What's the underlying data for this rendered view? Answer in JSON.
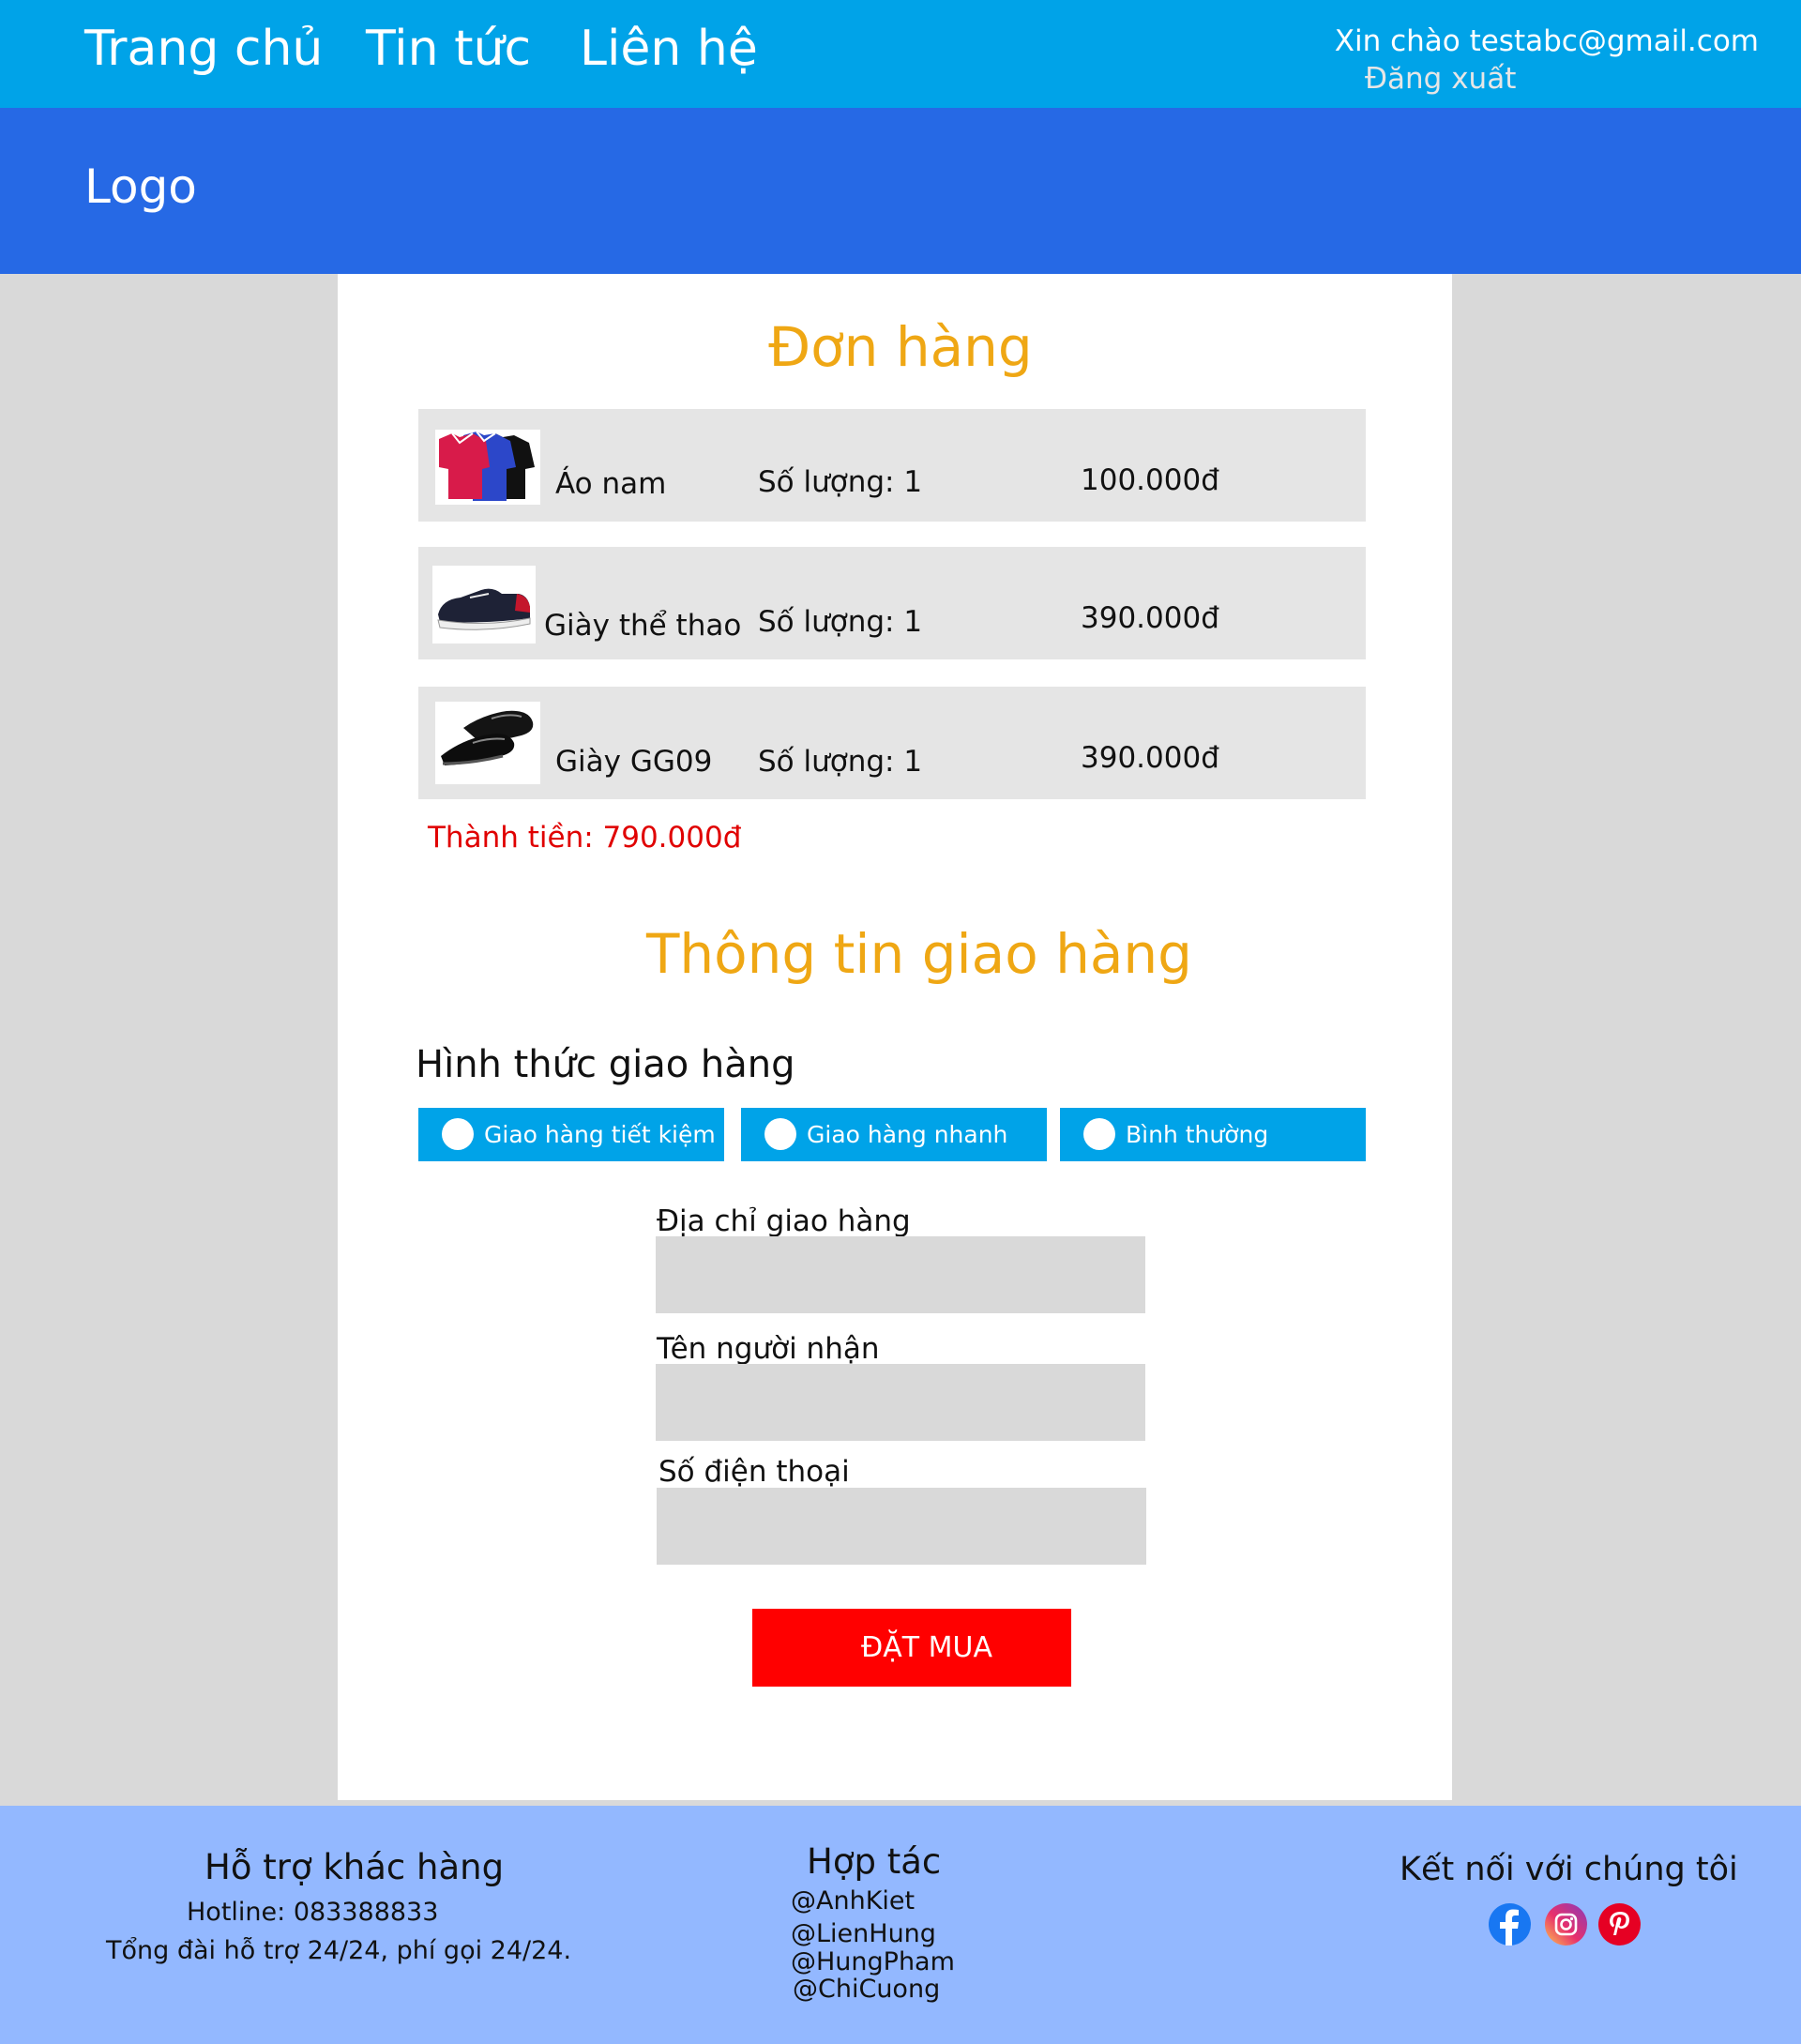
{
  "nav": {
    "links": [
      "Trang chủ",
      "Tin tức",
      "Liên hệ"
    ],
    "greeting": "Xin chào testabc@gmail.com",
    "logout": "Đăng xuất"
  },
  "header": {
    "logo": "Logo"
  },
  "order": {
    "title": "Đơn hàng",
    "items": [
      {
        "name": "Áo nam",
        "qty": "Số lượng: 1",
        "price": "100.000đ",
        "image": "shirts"
      },
      {
        "name": "Giày thể thao",
        "qty": "Số lượng: 1",
        "price": "390.000đ",
        "image": "sneaker"
      },
      {
        "name": "Giày GG09",
        "qty": "Số lượng: 1",
        "price": "390.000đ",
        "image": "dress-shoes"
      }
    ],
    "total": "Thành tiền: 790.000đ"
  },
  "shipping": {
    "title": "Thông tin giao hàng",
    "method_title": "Hình thức giao hàng",
    "options": [
      "Giao hàng tiết kiệm",
      "Giao hàng nhanh",
      "Bình thường"
    ],
    "fields": [
      {
        "label": "Địa chỉ giao hàng",
        "value": ""
      },
      {
        "label": "Tên người nhận",
        "value": ""
      },
      {
        "label": "Số điện thoại",
        "value": ""
      }
    ],
    "submit": "ĐẶT MUA"
  },
  "footer": {
    "support": {
      "title": "Hỗ trợ khác hàng",
      "hotline": "Hotline: 083388833",
      "note": "Tổng đài hỗ trợ 24/24, phí gọi 24/24."
    },
    "partners": {
      "title": "Hợp tác",
      "names": [
        "@AnhKiet",
        "@LienHung",
        "@HungPham",
        "@ChiCuong"
      ]
    },
    "connect": {
      "title": "Kết nối với chúng tôi",
      "icons": [
        "facebook-icon",
        "instagram-icon",
        "pinterest-icon"
      ]
    }
  },
  "colors": {
    "topbar": "#00a3e8",
    "header": "#2669e5",
    "accent_title": "#efa714",
    "total": "#e00000",
    "button": "#ff0000",
    "footer": "#93b8ff"
  }
}
